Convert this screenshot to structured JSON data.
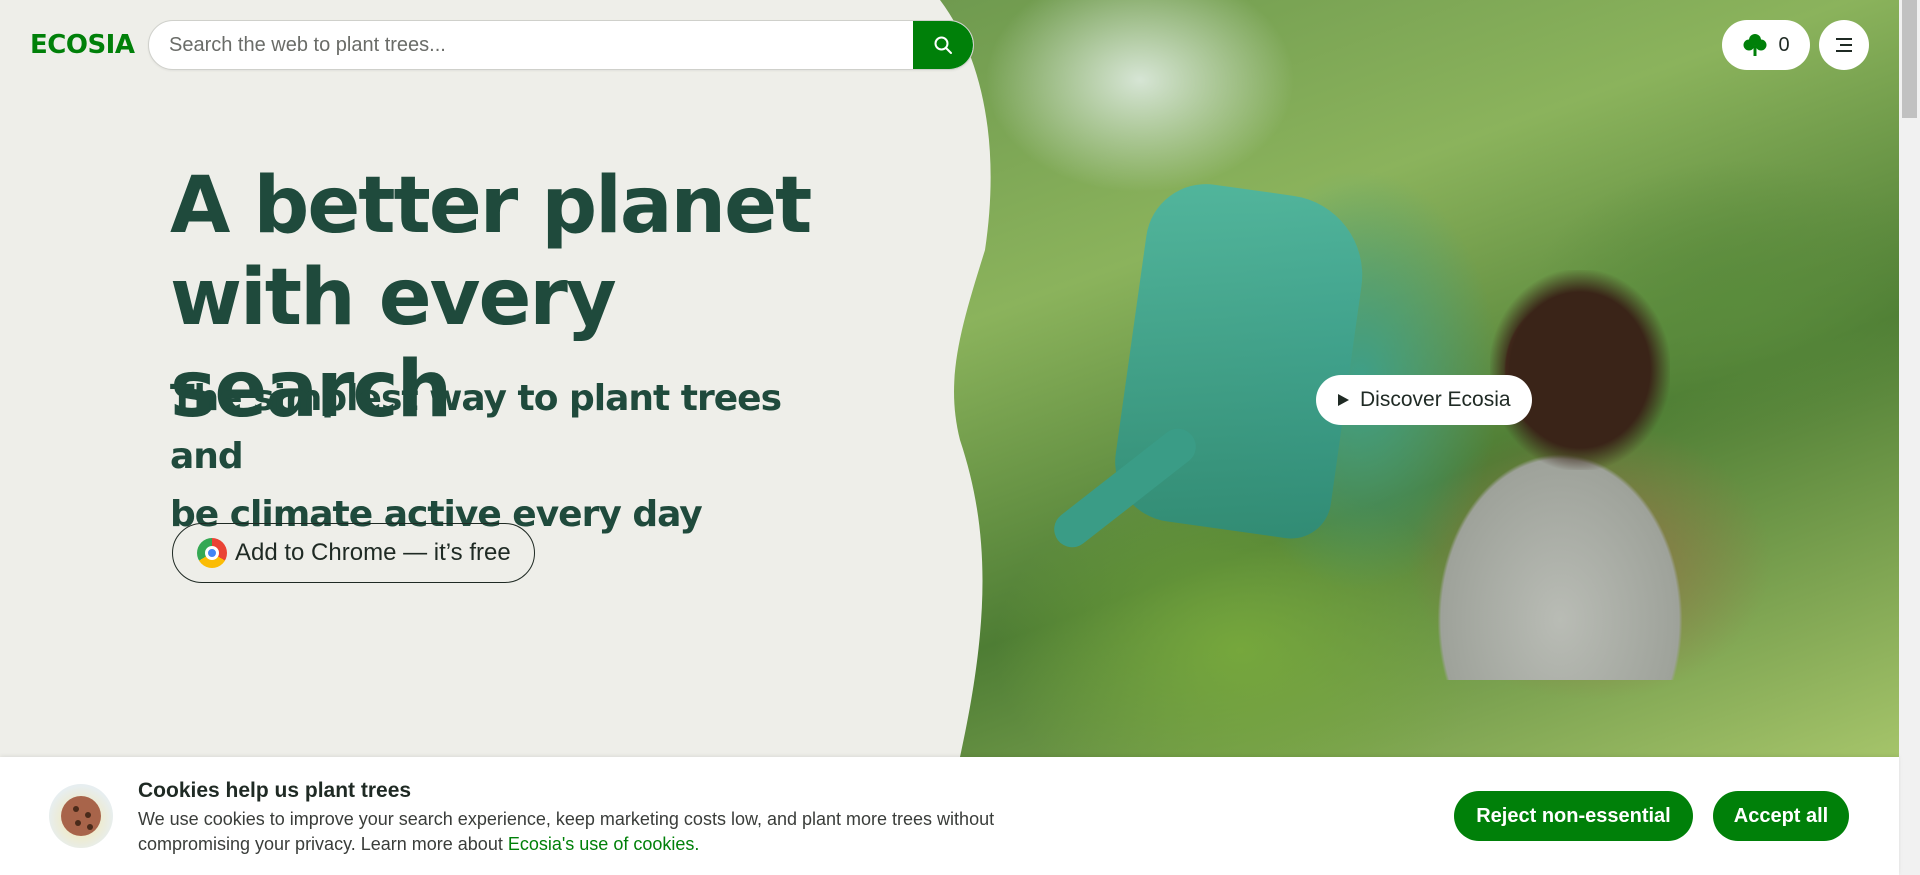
{
  "brand": {
    "logo_text": "ECOSIA",
    "accent": "#008009",
    "heading_color": "#1f4a3c",
    "background": "#eeeee9"
  },
  "search": {
    "placeholder": "Search the web to plant trees...",
    "icon": "search-icon"
  },
  "header": {
    "tree_count": "0",
    "tree_icon": "tree-icon",
    "menu_icon": "hamburger-menu-icon"
  },
  "hero": {
    "headline_line1": "A better planet",
    "headline_line2": "with every search",
    "subline_line1": "The simplest way to plant trees and",
    "subline_line2": "be climate active every day",
    "cta_label": "Add to Chrome — it’s free",
    "cta_icon": "chrome-icon",
    "discover_label": "Discover Ecosia",
    "discover_icon": "play-icon"
  },
  "cookie_banner": {
    "title": "Cookies help us plant trees",
    "text_line1": "We use cookies to improve your search experience, keep marketing costs low, and plant more trees without",
    "text_line2": "compromising your privacy. Learn more about ",
    "link_text": "Ecosia's use of cookies.",
    "reject_label": "Reject non-essential",
    "accept_label": "Accept all",
    "icon": "cookie-icon"
  }
}
